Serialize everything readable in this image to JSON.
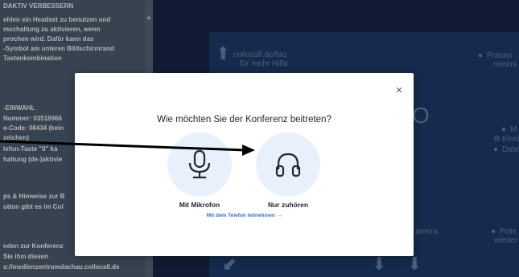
{
  "left_panel": {
    "lines": [
      "DAKTIV VERBESSERN",
      "ehlen ein Headset zu benutzen und",
      "mschaltung zu aktivieren, wenn",
      "prochen wird. Dafür kann das",
      "-Symbol am unteren Bildschirmrand",
      "Tastenkombination",
      "",
      "-EINWAHL",
      "Nummer: 03518966",
      "e-Code: 08434 (kein",
      "zeichen)",
      "lefon-Taste \"0\" ka",
      "haltung (de-)aktivie",
      "",
      "ps & Hinweise zur B",
      "utton gibt es im Col",
      "",
      "",
      "nden zur Konferenz",
      "Sie ihm diesen",
      "s://medienzentrumdachau.collocall.de"
    ]
  },
  "stage": {
    "faq_line1": "collocall.de/faq",
    "faq_line2": "für mehr Hilfe",
    "right_top_1": "Präsen",
    "right_top_2": "minimi",
    "right_mid_1": "M",
    "right_mid_2": "Einste",
    "right_mid_3": "Date",
    "camera": "amera",
    "right_bottom_1": "Präs",
    "right_bottom_2": "wieder"
  },
  "dialog": {
    "title": "Wie möchten Sie der Konferenz beitreten?",
    "close_symbol": "×",
    "options": [
      {
        "label": "Mit Mikrofon",
        "icon": "microphone-icon"
      },
      {
        "label": "Nur zuhören",
        "icon": "headphones-icon"
      }
    ],
    "phone_link": "Mit dem Telefon teilnehmen →",
    "accent_color": "#2f6fd0",
    "icon_bg_color": "#e8f1fb"
  }
}
